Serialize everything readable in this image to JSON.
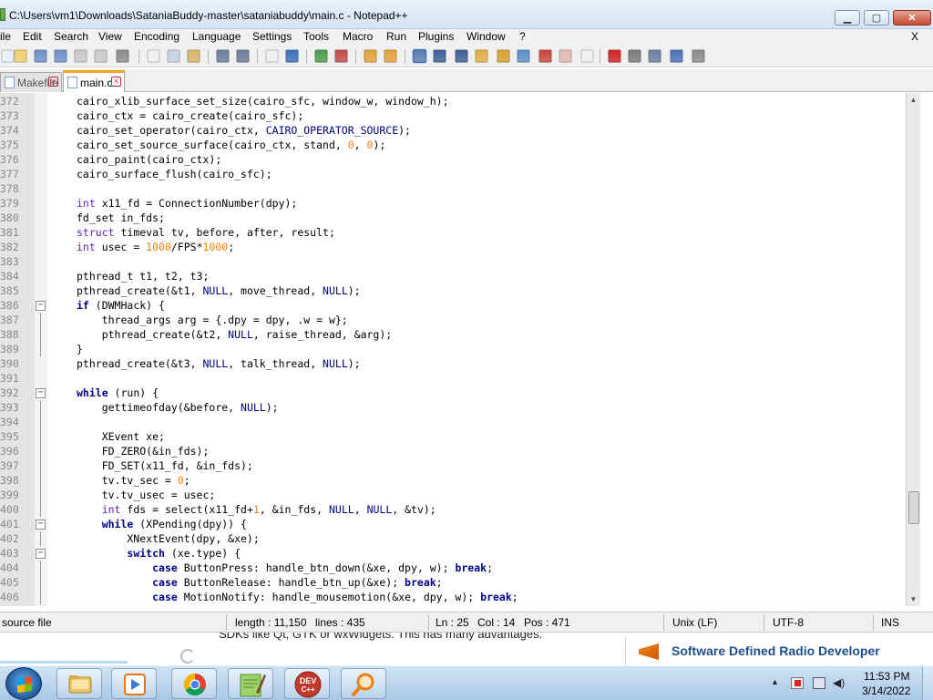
{
  "window": {
    "title": "C:\\Users\\vm1\\Downloads\\SataniaBuddy-master\\sataniabuddy\\main.c - Notepad++",
    "min_label": "▁",
    "max_label": "▢",
    "close_label": "✕"
  },
  "menu": {
    "items": [
      "ile",
      "Edit",
      "Search",
      "View",
      "Encoding",
      "Language",
      "Settings",
      "Tools",
      "Macro",
      "Run",
      "Plugins",
      "Window",
      "?"
    ],
    "close": "X"
  },
  "tabs": [
    {
      "label": "Makefile",
      "active": false
    },
    {
      "label": "main.c",
      "active": true
    }
  ],
  "editor": {
    "lines": [
      {
        "n": "372",
        "fold": "",
        "tokens": [
          [
            "",
            "cairo_xlib_surface_set_size(cairo_sfc, window_w, window_h);"
          ]
        ]
      },
      {
        "n": "373",
        "fold": "",
        "tokens": [
          [
            "",
            "cairo_ctx = cairo_create(cairo_sfc);"
          ]
        ]
      },
      {
        "n": "374",
        "fold": "",
        "tokens": [
          [
            "",
            "cairo_set_operator(cairo_ctx, "
          ],
          [
            "mc",
            "CAIRO_OPERATOR_SOURCE"
          ],
          [
            "",
            ");"
          ]
        ]
      },
      {
        "n": "375",
        "fold": "",
        "tokens": [
          [
            "",
            "cairo_set_source_surface(cairo_ctx, stand, "
          ],
          [
            "num",
            "0"
          ],
          [
            "",
            ", "
          ],
          [
            "num",
            "0"
          ],
          [
            "",
            ");"
          ]
        ]
      },
      {
        "n": "376",
        "fold": "",
        "tokens": [
          [
            "",
            "cairo_paint(cairo_ctx);"
          ]
        ]
      },
      {
        "n": "377",
        "fold": "",
        "tokens": [
          [
            "",
            "cairo_surface_flush(cairo_sfc);"
          ]
        ]
      },
      {
        "n": "378",
        "fold": "",
        "tokens": [
          [
            "",
            ""
          ]
        ]
      },
      {
        "n": "379",
        "fold": "",
        "tokens": [
          [
            "ty",
            "int"
          ],
          [
            "",
            " x11_fd = ConnectionNumber(dpy);"
          ]
        ]
      },
      {
        "n": "380",
        "fold": "",
        "tokens": [
          [
            "",
            "fd_set in_fds;"
          ]
        ]
      },
      {
        "n": "381",
        "fold": "",
        "tokens": [
          [
            "ty",
            "struct"
          ],
          [
            "",
            " timeval tv, before, after, result;"
          ]
        ]
      },
      {
        "n": "382",
        "fold": "",
        "tokens": [
          [
            "ty",
            "int"
          ],
          [
            "",
            " usec = "
          ],
          [
            "num",
            "1000"
          ],
          [
            "",
            "/FPS*"
          ],
          [
            "num",
            "1000"
          ],
          [
            "",
            ";"
          ]
        ]
      },
      {
        "n": "383",
        "fold": "",
        "tokens": [
          [
            "",
            ""
          ]
        ]
      },
      {
        "n": "384",
        "fold": "",
        "tokens": [
          [
            "",
            "pthread_t t1, t2, t3;"
          ]
        ]
      },
      {
        "n": "385",
        "fold": "",
        "tokens": [
          [
            "",
            "pthread_create(&t1, "
          ],
          [
            "mc",
            "NULL"
          ],
          [
            "",
            ", move_thread, "
          ],
          [
            "mc",
            "NULL"
          ],
          [
            "",
            ");"
          ]
        ]
      },
      {
        "n": "386",
        "fold": "box",
        "tokens": [
          [
            "kw",
            "if"
          ],
          [
            "",
            " (DWMHack) {"
          ]
        ]
      },
      {
        "n": "387",
        "fold": "line",
        "tokens": [
          [
            "",
            "    thread_args arg = {.dpy = dpy, .w = w};"
          ]
        ]
      },
      {
        "n": "388",
        "fold": "line",
        "tokens": [
          [
            "",
            "    pthread_create(&t2, "
          ],
          [
            "mc",
            "NULL"
          ],
          [
            "",
            ", raise_thread, &arg);"
          ]
        ]
      },
      {
        "n": "389",
        "fold": "line",
        "tokens": [
          [
            "",
            "}"
          ]
        ]
      },
      {
        "n": "390",
        "fold": "",
        "tokens": [
          [
            "",
            "pthread_create(&t3, "
          ],
          [
            "mc",
            "NULL"
          ],
          [
            "",
            ", talk_thread, "
          ],
          [
            "mc",
            "NULL"
          ],
          [
            "",
            ");"
          ]
        ]
      },
      {
        "n": "391",
        "fold": "",
        "tokens": [
          [
            "",
            ""
          ]
        ]
      },
      {
        "n": "392",
        "fold": "box",
        "tokens": [
          [
            "kw",
            "while"
          ],
          [
            "",
            " (run) {"
          ]
        ]
      },
      {
        "n": "393",
        "fold": "line",
        "tokens": [
          [
            "",
            "    gettimeofday(&before, "
          ],
          [
            "mc",
            "NULL"
          ],
          [
            "",
            ");"
          ]
        ]
      },
      {
        "n": "394",
        "fold": "line",
        "tokens": [
          [
            "",
            ""
          ]
        ]
      },
      {
        "n": "395",
        "fold": "line",
        "tokens": [
          [
            "",
            "    XEvent xe;"
          ]
        ]
      },
      {
        "n": "396",
        "fold": "line",
        "tokens": [
          [
            "",
            "    FD_ZERO(&in_fds);"
          ]
        ]
      },
      {
        "n": "397",
        "fold": "line",
        "tokens": [
          [
            "",
            "    FD_SET(x11_fd, &in_fds);"
          ]
        ]
      },
      {
        "n": "398",
        "fold": "line",
        "tokens": [
          [
            "",
            "    tv.tv_sec = "
          ],
          [
            "num",
            "0"
          ],
          [
            "",
            ";"
          ]
        ]
      },
      {
        "n": "399",
        "fold": "line",
        "tokens": [
          [
            "",
            "    tv.tv_usec = usec;"
          ]
        ]
      },
      {
        "n": "400",
        "fold": "line",
        "tokens": [
          [
            "",
            "    "
          ],
          [
            "ty",
            "int"
          ],
          [
            "",
            " fds = select(x11_fd+"
          ],
          [
            "num",
            "1"
          ],
          [
            "",
            ", &in_fds, "
          ],
          [
            "mc",
            "NULL"
          ],
          [
            "",
            ", "
          ],
          [
            "mc",
            "NULL"
          ],
          [
            "",
            ", &tv);"
          ]
        ]
      },
      {
        "n": "401",
        "fold": "box",
        "tokens": [
          [
            "",
            "    "
          ],
          [
            "kw",
            "while"
          ],
          [
            "",
            " (XPending(dpy)) {"
          ]
        ]
      },
      {
        "n": "402",
        "fold": "line",
        "tokens": [
          [
            "",
            "        XNextEvent(dpy, &xe);"
          ]
        ]
      },
      {
        "n": "403",
        "fold": "box",
        "tokens": [
          [
            "",
            "        "
          ],
          [
            "kw",
            "switch"
          ],
          [
            "",
            " (xe.type) {"
          ]
        ]
      },
      {
        "n": "404",
        "fold": "line",
        "tokens": [
          [
            "",
            "            "
          ],
          [
            "kw",
            "case"
          ],
          [
            "",
            " ButtonPress: handle_btn_down(&xe, dpy, w); "
          ],
          [
            "kw",
            "break"
          ],
          [
            "",
            ";"
          ]
        ]
      },
      {
        "n": "405",
        "fold": "line",
        "tokens": [
          [
            "",
            "            "
          ],
          [
            "kw",
            "case"
          ],
          [
            "",
            " ButtonRelease: handle_btn_up(&xe); "
          ],
          [
            "kw",
            "break"
          ],
          [
            "",
            ";"
          ]
        ]
      },
      {
        "n": "406",
        "fold": "line",
        "tokens": [
          [
            "",
            "            "
          ],
          [
            "kw",
            "case"
          ],
          [
            "",
            " MotionNotify: handle_mousemotion(&xe, dpy, w); "
          ],
          [
            "kw",
            "break"
          ],
          [
            "",
            ";"
          ]
        ]
      }
    ]
  },
  "status": {
    "file_type": "source file",
    "length": "length : 11,150",
    "lines": "lines : 435",
    "ln": "Ln : 25",
    "col": "Col : 14",
    "pos": "Pos : 471",
    "eol": "Unix (LF)",
    "encoding": "UTF-8",
    "mode": "INS"
  },
  "background_window": {
    "fragment": "SDKs like Qt, GTK or wxWidgets. This has many advantages.",
    "ad_text": "Software Defined Radio Developer"
  },
  "taskbar": {
    "apps": [
      {
        "name": "file-explorer"
      },
      {
        "name": "media-player"
      },
      {
        "name": "chrome"
      },
      {
        "name": "notepad-plus-plus"
      },
      {
        "name": "dev-cpp",
        "label": "DEV\nC++"
      },
      {
        "name": "search-tool"
      }
    ],
    "time": "11:53 PM",
    "date": "3/14/2022"
  },
  "colors": {
    "keyword": "#00008b",
    "type": "#6020c0",
    "number": "#ff8000",
    "macro": "#000080",
    "active_tab_accent": "#f5a623"
  }
}
